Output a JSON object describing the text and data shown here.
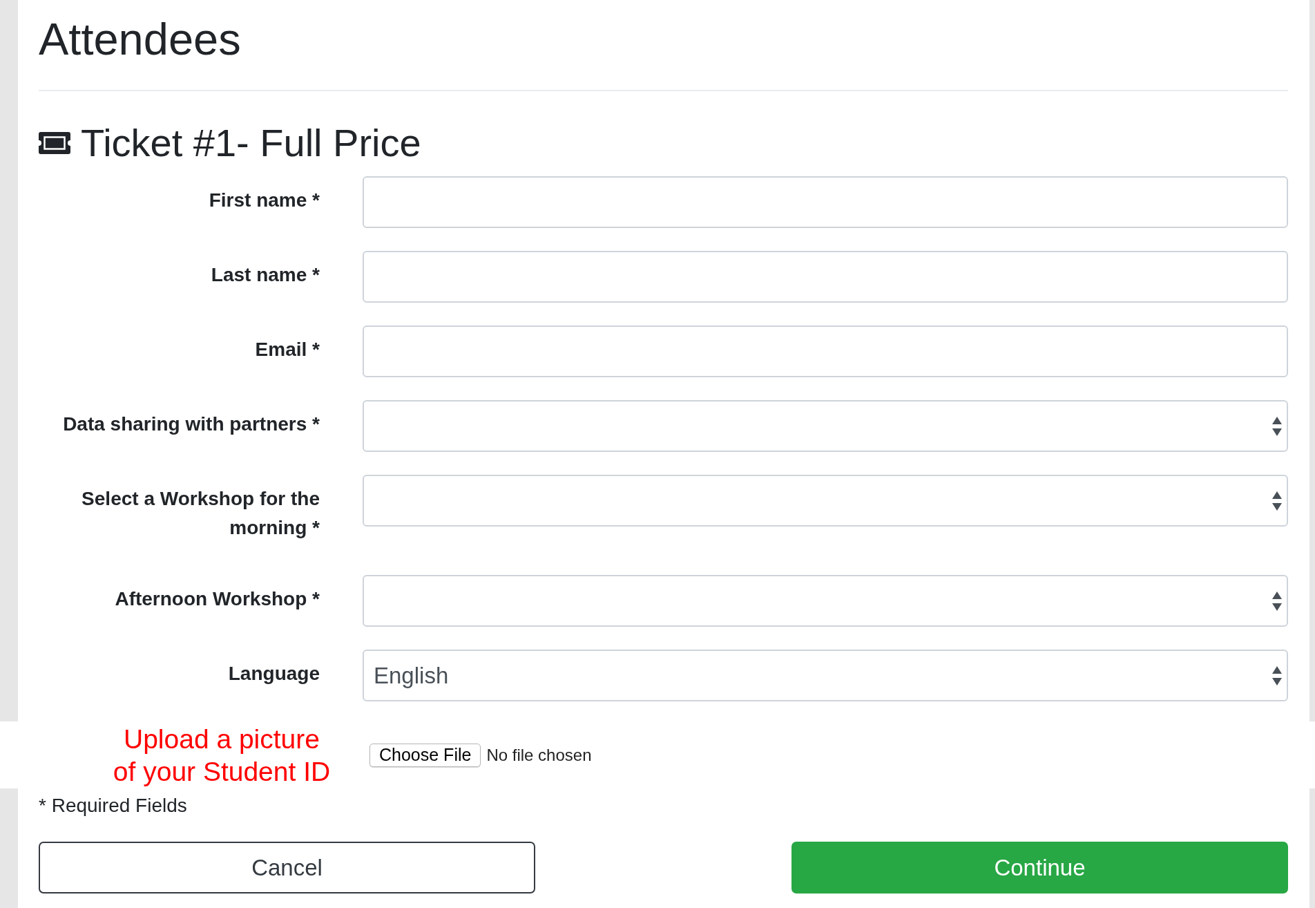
{
  "page": {
    "title": "Attendees"
  },
  "ticket": {
    "title": "Ticket #1- Full Price",
    "fields": [
      {
        "kind": "text",
        "label": "First name *"
      },
      {
        "kind": "text",
        "label": "Last name *"
      },
      {
        "kind": "text",
        "label": "Email *"
      },
      {
        "kind": "select",
        "label": "Data sharing with partners *"
      },
      {
        "kind": "select",
        "label": "Select a Workshop for the morning *"
      },
      {
        "kind": "select",
        "label": "Afternoon Workshop *"
      },
      {
        "kind": "select",
        "label": "Language",
        "value": "English"
      }
    ]
  },
  "upload": {
    "label": "Upload a picture of your Student ID",
    "button": "Choose File",
    "status": "No file chosen"
  },
  "note": "* Required Fields",
  "buttons": [
    {
      "kind": "outline",
      "label": "Cancel"
    },
    {
      "kind": "primary",
      "label": "Continue"
    }
  ]
}
